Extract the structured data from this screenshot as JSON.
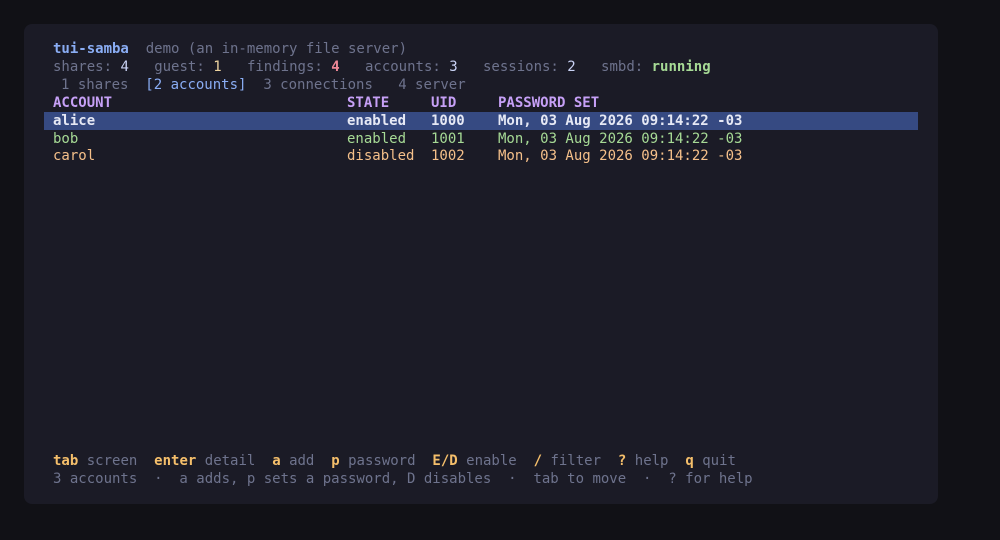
{
  "header": {
    "app": "tui-samba",
    "subtitle": "demo (an in-memory file server)"
  },
  "stats": {
    "shares_label": "shares:",
    "shares": "4",
    "guest_label": "guest:",
    "guest": "1",
    "findings_label": "findings:",
    "findings": "4",
    "accounts_label": "accounts:",
    "accounts": "3",
    "sessions_label": "sessions:",
    "sessions": "2",
    "smbd_label": "smbd:",
    "smbd": "running"
  },
  "tabs": [
    {
      "label": "1 shares"
    },
    {
      "label": "[2 accounts]"
    },
    {
      "label": "3 connections"
    },
    {
      "label": "4 server"
    }
  ],
  "table": {
    "columns": [
      "ACCOUNT",
      "STATE",
      "UID",
      "PASSWORD SET"
    ],
    "rows": [
      {
        "account": "alice",
        "state": "enabled",
        "uid": "1000",
        "pwset": "Mon, 03 Aug 2026 09:14:22 -03"
      },
      {
        "account": "bob",
        "state": "enabled",
        "uid": "1001",
        "pwset": "Mon, 03 Aug 2026 09:14:22 -03"
      },
      {
        "account": "carol",
        "state": "disabled",
        "uid": "1002",
        "pwset": "Mon, 03 Aug 2026 09:14:22 -03"
      }
    ]
  },
  "keys": [
    {
      "key": "tab",
      "desc": "screen"
    },
    {
      "key": "enter",
      "desc": "detail"
    },
    {
      "key": "a",
      "desc": "add"
    },
    {
      "key": "p",
      "desc": "password"
    },
    {
      "key": "E/D",
      "desc": "enable"
    },
    {
      "key": "/",
      "desc": "filter"
    },
    {
      "key": "?",
      "desc": "help"
    },
    {
      "key": "q",
      "desc": "quit"
    }
  ],
  "status": "3 accounts  ·  a adds, p sets a password, D disables  ·  tab to move  ·  ? for help",
  "colors": {
    "background": "#1b1b26",
    "selection": "#364a82",
    "accent": "#8aadf4",
    "header": "#c6a0f6",
    "key": "#f5bf6b",
    "running": "#a6da95",
    "findings": "#ed8796"
  }
}
